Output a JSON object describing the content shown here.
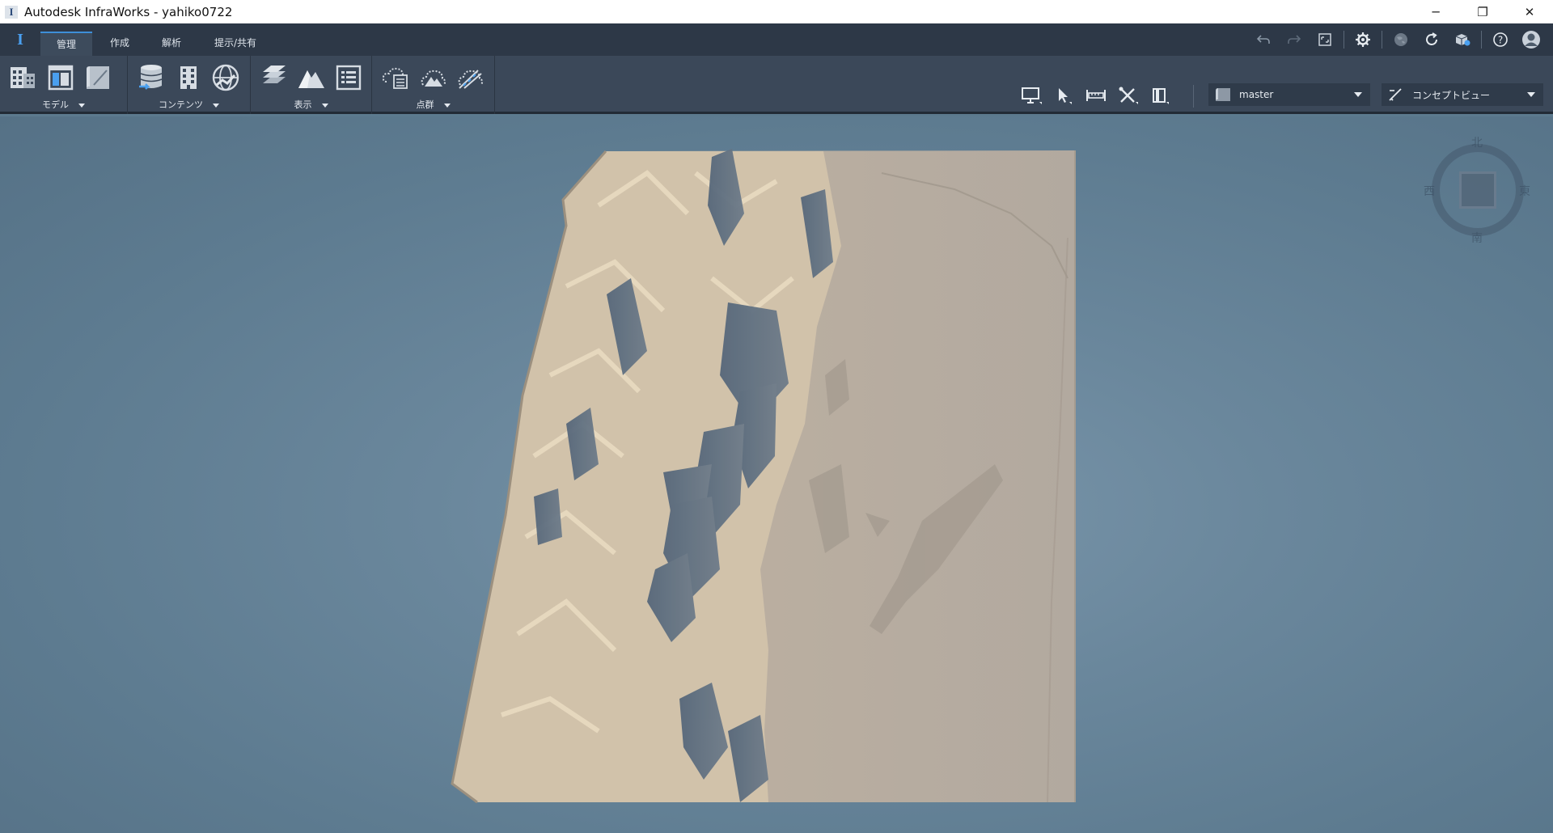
{
  "window": {
    "title": "Autodesk InfraWorks - yahiko0722",
    "app_icon": "I",
    "minimize": "─",
    "restore": "❐",
    "close": "✕"
  },
  "tabs": [
    {
      "label": "管理",
      "active": true
    },
    {
      "label": "作成",
      "active": false
    },
    {
      "label": "解析",
      "active": false
    },
    {
      "label": "提示/共有",
      "active": false
    }
  ],
  "ribbon": {
    "groups": [
      {
        "label": "モデル"
      },
      {
        "label": "コンテンツ"
      },
      {
        "label": "表示"
      },
      {
        "label": "点群"
      }
    ]
  },
  "dropdowns": {
    "proposal": "master",
    "view_mode": "コンセプトビュー"
  },
  "compass": {
    "north": "北",
    "south": "南",
    "east": "東",
    "west": "西"
  },
  "colors": {
    "accent": "#3e8fd8",
    "tab_bar": "#2d3847",
    "ribbon": "#3b4859",
    "viewport": "#6a879c",
    "terrain": "#c9bcab"
  }
}
